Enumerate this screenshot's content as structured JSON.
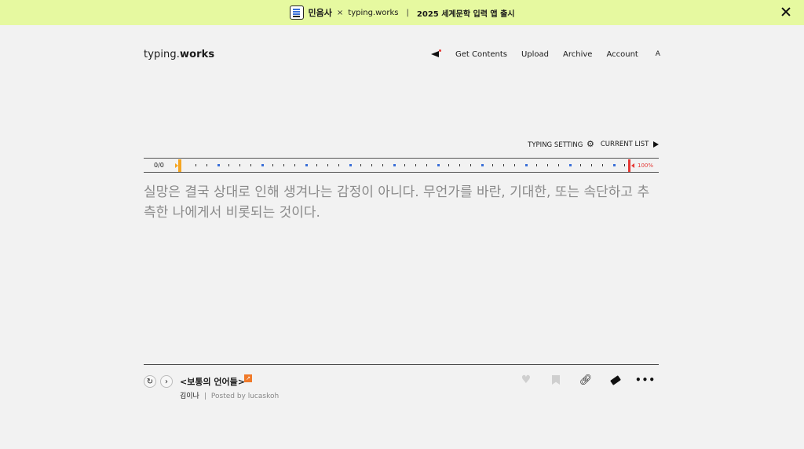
{
  "banner": {
    "brand": "민음사",
    "cross": "×",
    "site": "typing.works",
    "separator": "|",
    "title": "2025 세계문학 입력 앱 출시"
  },
  "header": {
    "logo_light": "typing.",
    "logo_bold": "works",
    "nav": [
      "Get Contents",
      "Upload",
      "Archive",
      "Account"
    ],
    "avatar": "A"
  },
  "controls": {
    "typing_setting": "TYPING SETTING",
    "current_list": "CURRENT LIST"
  },
  "progress": {
    "count": "0/0",
    "percent_label": "100%",
    "progress_fraction": 0
  },
  "passage": {
    "text": "실망은 결국 상대로 인해 생겨나는 감정이 아니다. 무언가를 바란, 기대한, 또는 속단하고 추측한 나에게서 비롯되는 것이다."
  },
  "footer": {
    "book_title": "<보통의 언어들>",
    "author": "김이나",
    "byline_sep": "|",
    "posted_by": "Posted by lucaskoh"
  },
  "icons": {
    "restart": "restart-icon",
    "next": "chevron-right-icon",
    "like": "heart-icon",
    "bookmark": "bookmark-icon",
    "link": "link-icon",
    "eraser": "eraser-icon",
    "more": "more-icon"
  },
  "colors": {
    "banner_bg": "#e6f9a0",
    "page_bg": "#f2f2f2",
    "progress_start": "#f5a623",
    "progress_end": "#e53935",
    "tick_accent": "#3a6fd8",
    "external_badge": "#f07a2a"
  }
}
